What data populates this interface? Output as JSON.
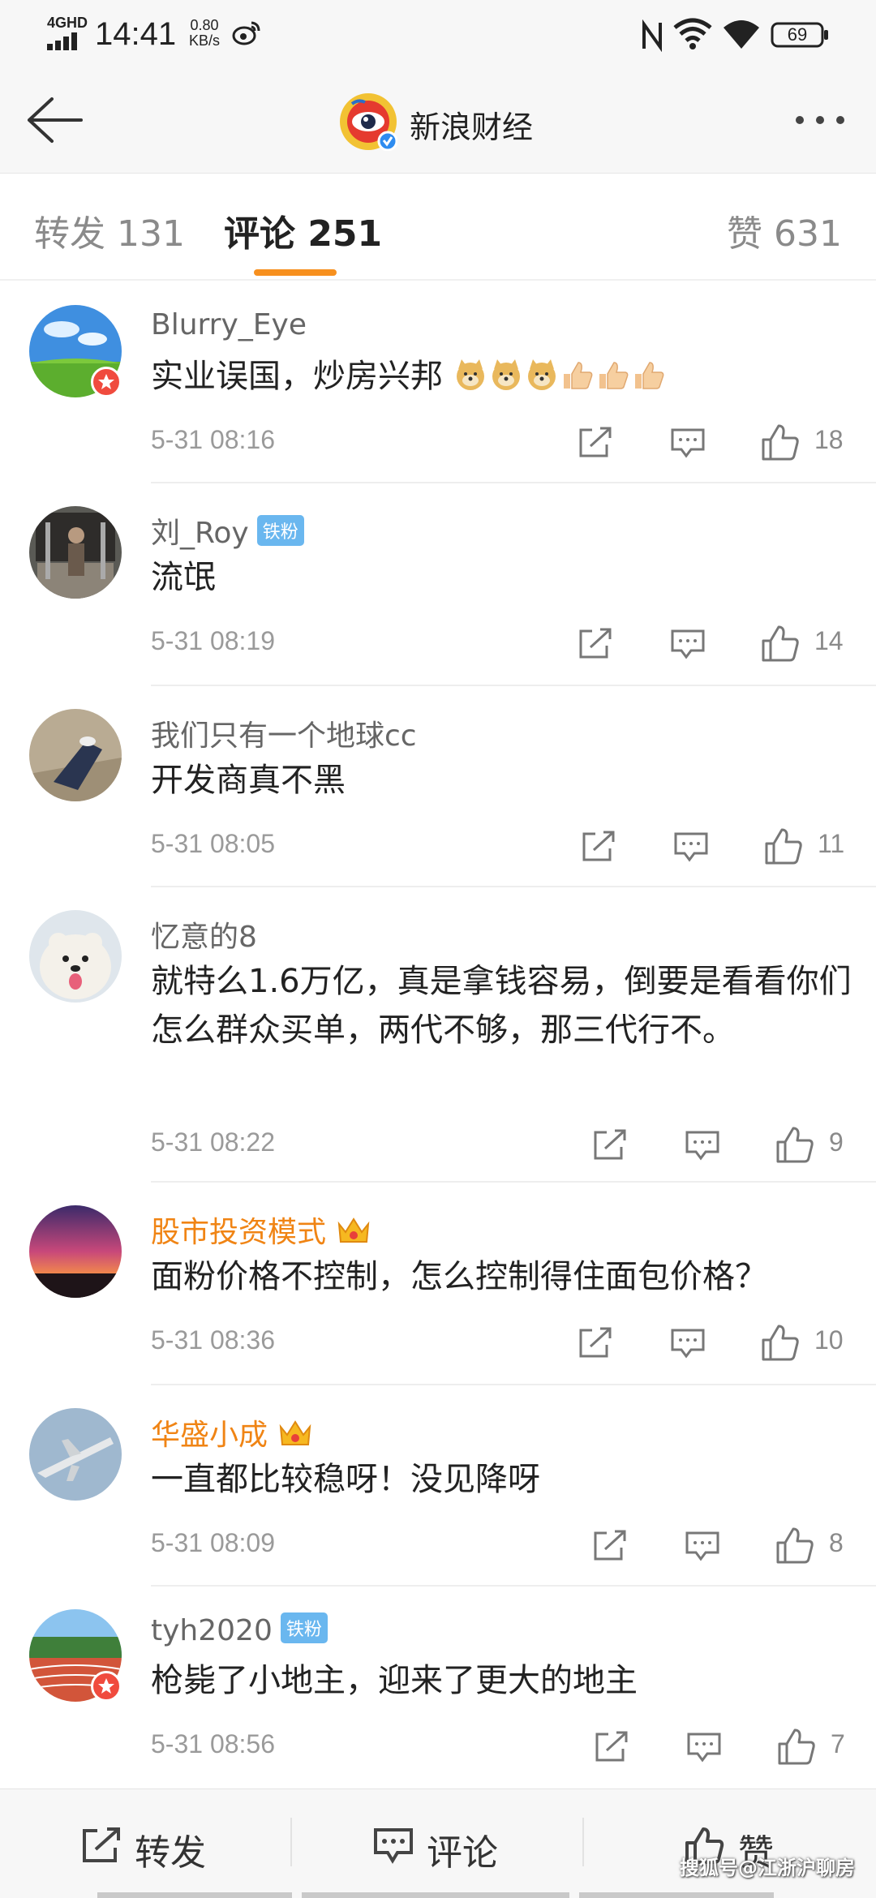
{
  "status_bar": {
    "network": "4GHD",
    "time": "14:41",
    "speed_value": "0.80",
    "speed_unit": "KB/s",
    "battery": "69"
  },
  "nav": {
    "title": "新浪财经"
  },
  "tabs": {
    "repost": "转发 131",
    "comment": "评论 251",
    "like": "赞 631",
    "active_color": "#f7901e"
  },
  "comments": [
    {
      "user": "Blurry_Eye",
      "text": "实业误国，炒房兴邦",
      "time": "5-31 08:16",
      "likes": "18"
    },
    {
      "user": "刘_Roy",
      "badge": "铁粉",
      "text": "流氓",
      "time": "5-31 08:19",
      "likes": "14"
    },
    {
      "user": "我们只有一个地球cc",
      "text": "开发商真不黑",
      "time": "5-31 08:05",
      "likes": "11"
    },
    {
      "user": "忆意的8",
      "text": "就特么1.6万亿，真是拿钱容易，倒要是看看你们怎么群众买单，两代不够，那三代行不。",
      "time": "5-31 08:22",
      "likes": "9"
    },
    {
      "user": "股市投资模式",
      "text": "面粉价格不控制，怎么控制得住面包价格？",
      "time": "5-31 08:36",
      "likes": "10"
    },
    {
      "user": "华盛小成",
      "text": "一直都比较稳呀！没见降呀",
      "time": "5-31 08:09",
      "likes": "8"
    },
    {
      "user": "tyh2020",
      "badge": "铁粉",
      "text": "枪毙了小地主，迎来了更大的地主",
      "time": "5-31 08:56",
      "likes": "7"
    }
  ],
  "bottom_bar": {
    "repost": "转发",
    "comment": "评论",
    "like": "赞"
  },
  "watermark": "搜狐号@江浙沪聊房",
  "colors": {
    "vip_name": "#f08414",
    "fan_badge": "#6ab7ef",
    "badge_red": "#f04b3e"
  }
}
